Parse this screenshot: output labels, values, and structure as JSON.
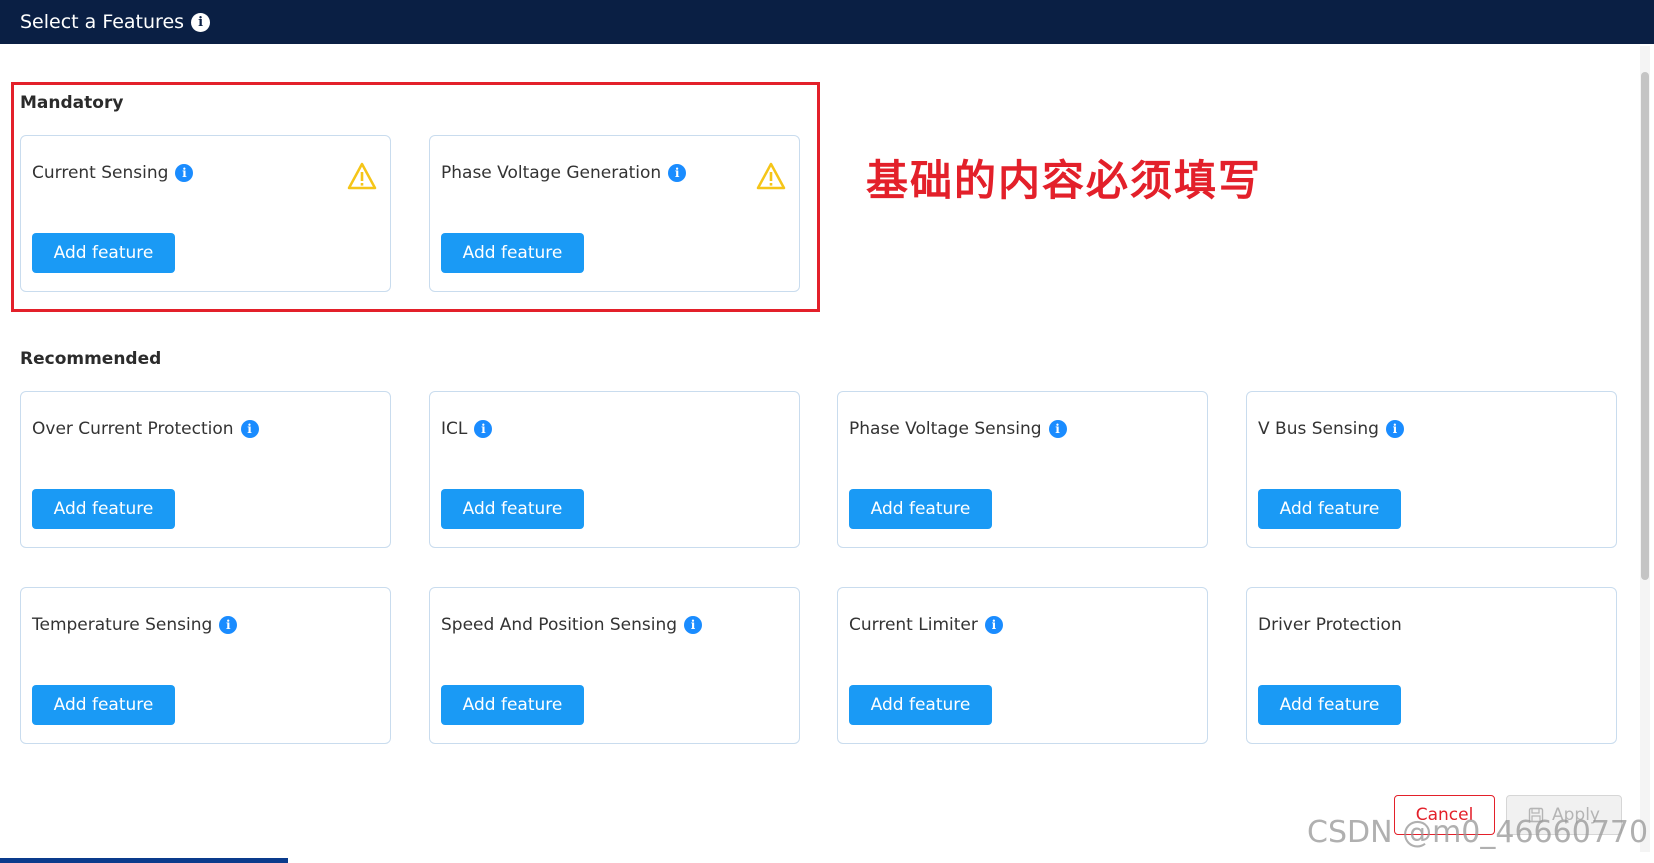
{
  "dialog": {
    "title": "Select a Features",
    "title_info_icon": "info-icon"
  },
  "mandatory": {
    "heading": "Mandatory",
    "cards": [
      {
        "name": "Current Sensing",
        "info_icon": "info-icon",
        "warning_icon": "warning-icon",
        "button": "Add feature"
      },
      {
        "name": "Phase Voltage Generation",
        "info_icon": "info-icon",
        "warning_icon": "warning-icon",
        "button": "Add feature"
      }
    ]
  },
  "annotation": {
    "text": "基础的内容必须填写",
    "color": "#e3202a"
  },
  "recommended": {
    "heading": "Recommended",
    "cards": [
      {
        "name": "Over Current Protection",
        "info_icon": "info-icon",
        "button": "Add feature"
      },
      {
        "name": "ICL",
        "info_icon": "info-icon",
        "button": "Add feature"
      },
      {
        "name": "Phase Voltage Sensing",
        "info_icon": "info-icon",
        "button": "Add feature"
      },
      {
        "name": "V Bus Sensing",
        "info_icon": "info-icon",
        "button": "Add feature"
      },
      {
        "name": "Temperature Sensing",
        "info_icon": "info-icon",
        "button": "Add feature"
      },
      {
        "name": "Speed And Position Sensing",
        "info_icon": "info-icon",
        "button": "Add feature"
      },
      {
        "name": "Current Limiter",
        "info_icon": "info-icon",
        "button": "Add feature"
      },
      {
        "name": "Driver Protection",
        "button": "Add feature"
      }
    ]
  },
  "footer": {
    "cancel_label": "Cancel",
    "apply_label": "Apply",
    "apply_icon": "save-icon"
  },
  "watermark": "CSDN @m0_46660770",
  "colors": {
    "header_bg": "#0a1f44",
    "accent_blue": "#1a9af5",
    "info_blue": "#1a8cff",
    "warning_yellow": "#f5c518",
    "annotation_red": "#e3202a"
  }
}
